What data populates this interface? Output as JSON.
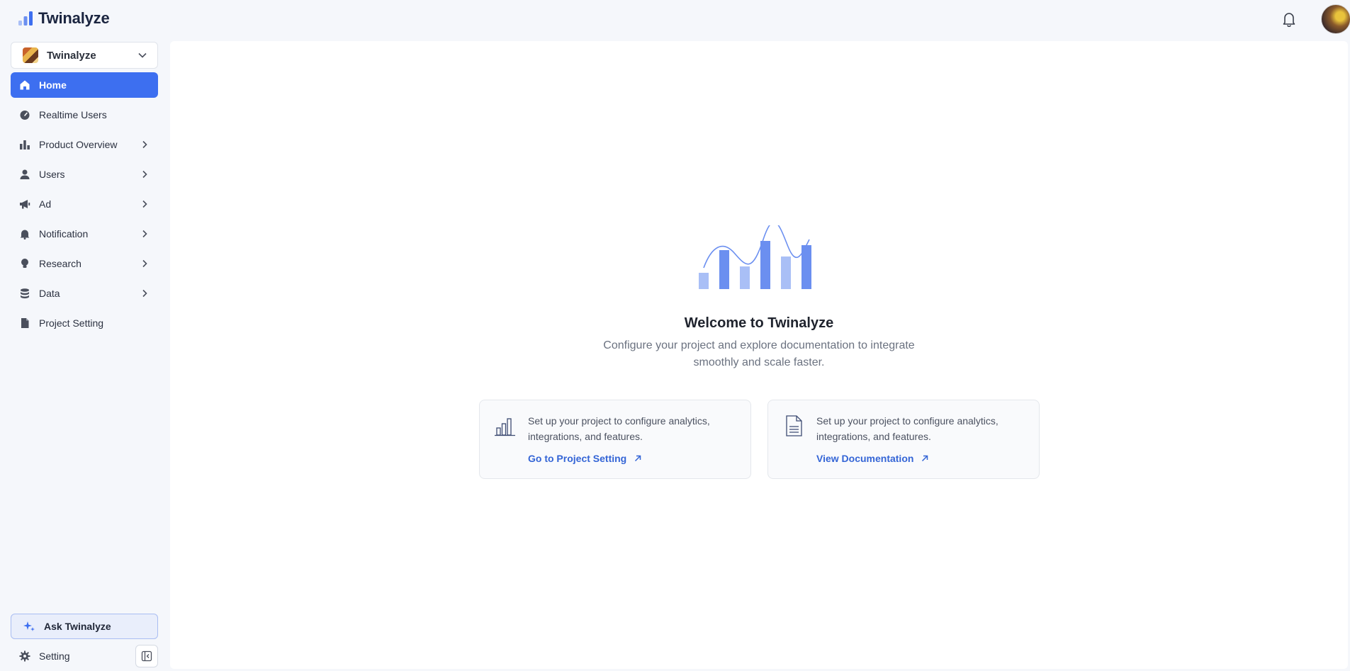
{
  "app": {
    "name": "Twinalyze"
  },
  "project": {
    "name": "Twinalyze"
  },
  "nav": {
    "items": [
      {
        "label": "Home"
      },
      {
        "label": "Realtime Users"
      },
      {
        "label": "Product Overview"
      },
      {
        "label": "Users"
      },
      {
        "label": "Ad"
      },
      {
        "label": "Notification"
      },
      {
        "label": "Research"
      },
      {
        "label": "Data"
      },
      {
        "label": "Project Setting"
      }
    ]
  },
  "sidebar_footer": {
    "ask_label": "Ask Twinalyze",
    "setting_label": "Setting"
  },
  "hero": {
    "title": "Welcome to Twinalyze",
    "subtitle": "Configure your project and explore documentation to integrate smoothly and scale faster."
  },
  "cards": [
    {
      "text": "Set up your project to configure analytics, integrations, and features.",
      "link": "Go to Project Setting"
    },
    {
      "text": "Set up your project to configure analytics, integrations, and features.",
      "link": "View Documentation"
    }
  ],
  "colors": {
    "accent": "#3d6ff0",
    "link": "#3465d6",
    "illus_dark": "#6b8ff0",
    "illus_light": "#a9bff6"
  }
}
